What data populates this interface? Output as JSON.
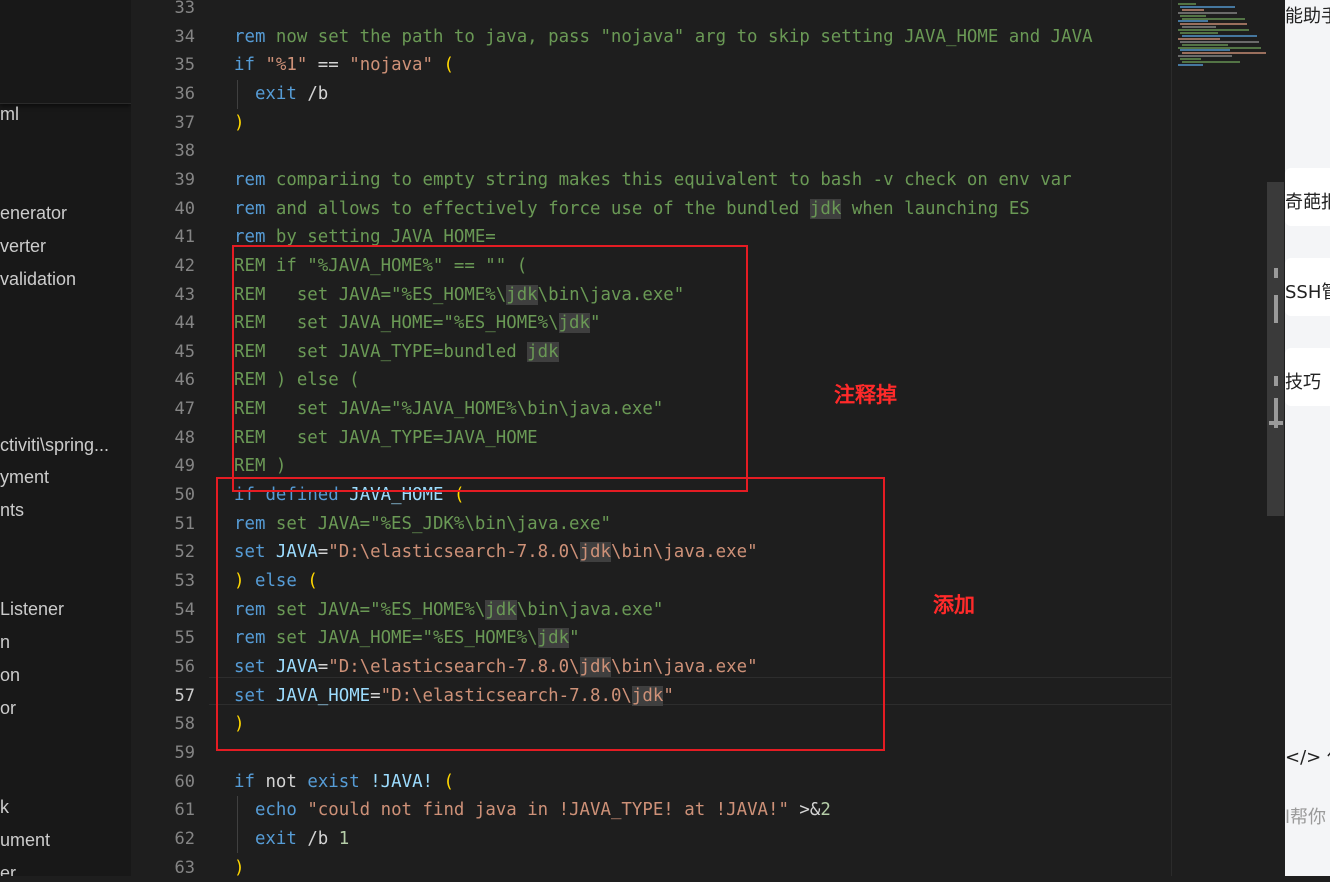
{
  "explorer": {
    "items": [
      "ml",
      "enerator",
      "verter",
      "validation",
      "ctiviti\\spring...",
      "yment",
      "nts",
      "Listener",
      "n",
      "on",
      "or",
      "k",
      "ument",
      "er"
    ]
  },
  "editor": {
    "line_numbers": [
      "33",
      "34",
      "35",
      "36",
      "37",
      "38",
      "39",
      "40",
      "41",
      "42",
      "43",
      "44",
      "45",
      "46",
      "47",
      "48",
      "49",
      "50",
      "51",
      "52",
      "53",
      "54",
      "55",
      "56",
      "57",
      "58",
      "59",
      "60",
      "61",
      "62",
      "63"
    ],
    "active_line": "57",
    "lines": [
      "",
      "rem now set the path to java, pass \"nojava\" arg to skip setting JAVA_HOME and JAVA",
      "if \"%1\" == \"nojava\" (",
      "  exit /b",
      ")",
      "",
      "rem compariing to empty string makes this equivalent to bash -v check on env var",
      "rem and allows to effectively force use of the bundled jdk when launching ES",
      "rem by setting JAVA_HOME=",
      "REM if \"%JAVA_HOME%\" == \"\" (",
      "REM   set JAVA=\"%ES_HOME%\\jdk\\bin\\java.exe\"",
      "REM   set JAVA_HOME=\"%ES_HOME%\\jdk\"",
      "REM   set JAVA_TYPE=bundled jdk",
      "REM ) else (",
      "REM   set JAVA=\"%JAVA_HOME%\\bin\\java.exe\"",
      "REM   set JAVA_TYPE=JAVA_HOME",
      "REM )",
      "if defined JAVA_HOME (",
      "rem set JAVA=\"%ES_JDK%\\bin\\java.exe\"",
      "set JAVA=\"D:\\elasticsearch-7.8.0\\jdk\\bin\\java.exe\"",
      ") else (",
      "rem set JAVA=\"%ES_HOME%\\jdk\\bin\\java.exe\"",
      "rem set JAVA_HOME=\"%ES_HOME%\\jdk\"",
      "set JAVA=\"D:\\elasticsearch-7.8.0\\jdk\\bin\\java.exe\"",
      "set JAVA_HOME=\"D:\\elasticsearch-7.8.0\\jdk\"",
      ")",
      "",
      "if not exist !JAVA! (",
      "  echo \"could not find java in !JAVA_TYPE! at !JAVA!\" >&2",
      "  exit /b 1",
      ")"
    ]
  },
  "annotations": {
    "comment_out_label": "注释掉",
    "add_label": "添加"
  },
  "right_panel": {
    "items": [
      "能助手",
      "奇葩报",
      "SSH管",
      "技巧",
      "</> 代",
      "l帮你"
    ]
  },
  "colors": {
    "keyword": "#569cd6",
    "string": "#ce9178",
    "comment": "#6a9955",
    "annotation": "#e51c23"
  }
}
